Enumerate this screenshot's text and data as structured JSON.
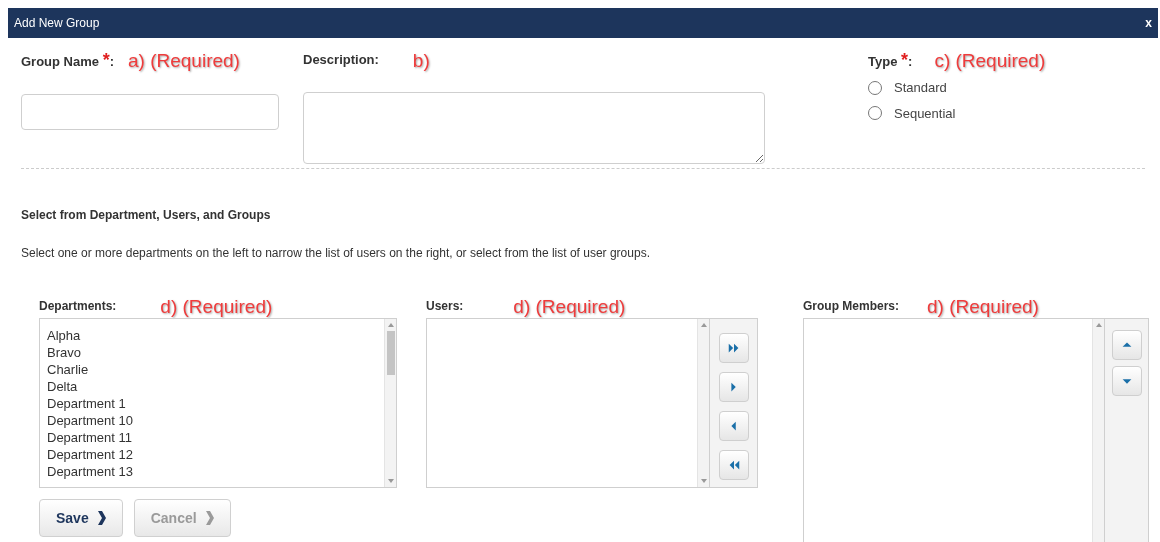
{
  "dialog": {
    "title": "Add New Group",
    "close": "x"
  },
  "fields": {
    "group_name": {
      "label": "Group Name",
      "required_mark": "*",
      "colon": ":",
      "annotation": "a) (Required)"
    },
    "description": {
      "label": "Description:",
      "annotation": "b)"
    },
    "type": {
      "label": "Type",
      "required_mark": "*",
      "colon": ":",
      "annotation": "c) (Required)",
      "options": [
        {
          "label": "Standard",
          "selected": false
        },
        {
          "label": "Sequential",
          "selected": false
        }
      ]
    }
  },
  "section": {
    "heading": "Select from Department, Users, and Groups",
    "instructions": "Select one or more departments on the left to narrow the list of users on the right, or select from the list of user groups."
  },
  "departments": {
    "label": "Departments:",
    "annotation": "d) (Required)",
    "items": [
      "Alpha",
      "Bravo",
      "Charlie",
      "Delta",
      "Department 1",
      "Department 10",
      "Department 11",
      "Department 12",
      "Department 13"
    ]
  },
  "users": {
    "label": "Users:",
    "annotation": "d) (Required)"
  },
  "transfer_buttons": [
    {
      "kind": "add_all"
    },
    {
      "kind": "add"
    },
    {
      "kind": "remove"
    },
    {
      "kind": "remove_all"
    }
  ],
  "group_members": {
    "label": "Group Members:",
    "annotation": "d) (Required)"
  },
  "order_buttons": [
    {
      "kind": "up"
    },
    {
      "kind": "down"
    }
  ],
  "buttons": [
    {
      "label": "Save",
      "disabled": false
    },
    {
      "label": "Cancel",
      "disabled": true
    }
  ]
}
